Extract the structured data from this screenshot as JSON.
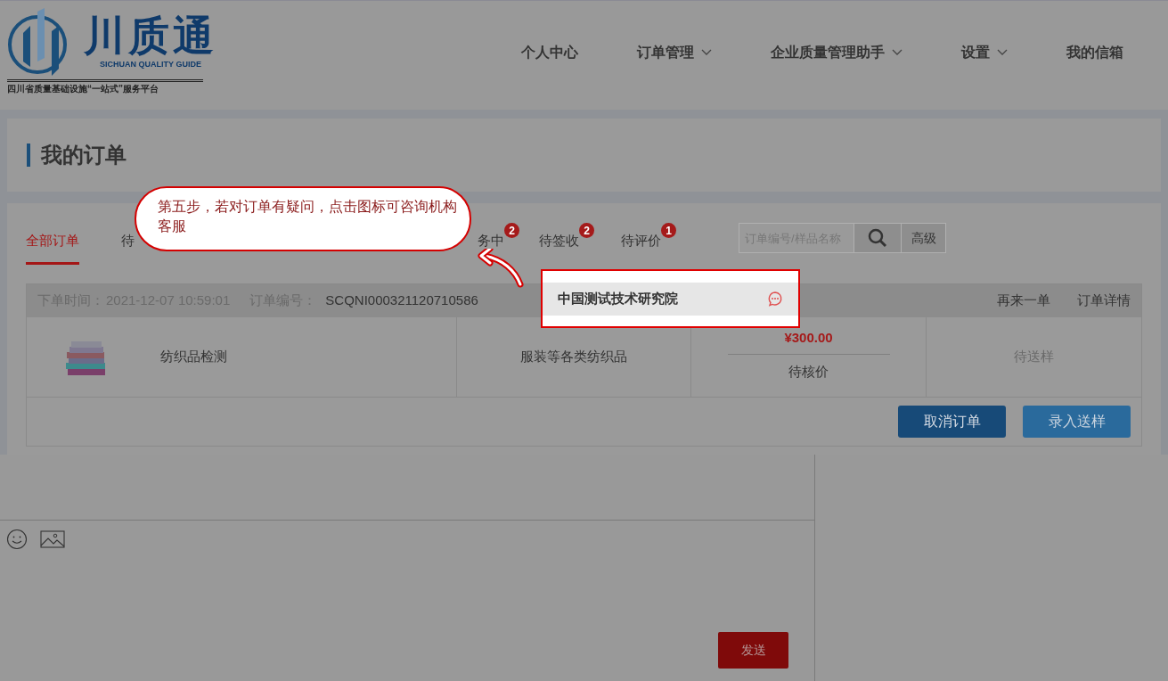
{
  "logo": {
    "name": "川质通",
    "subtitle": "SICHUAN QUALITY GUIDE",
    "slogan": "四川省质量基础设施“一站式”服务平台"
  },
  "nav": [
    {
      "label": "个人中心",
      "dropdown": false
    },
    {
      "label": "订单管理",
      "dropdown": true
    },
    {
      "label": "企业质量管理助手",
      "dropdown": true
    },
    {
      "label": "设置",
      "dropdown": true
    },
    {
      "label": "我的信箱",
      "dropdown": false
    }
  ],
  "page_title": "我的订单",
  "tabs": [
    {
      "label": "全部订单",
      "selected": true
    },
    {
      "label": "待",
      "selected": false
    },
    {
      "label": "务中",
      "selected": false,
      "badge": "2"
    },
    {
      "label": "待签收",
      "selected": false,
      "badge": "2"
    },
    {
      "label": "待评价",
      "selected": false,
      "badge": "1"
    }
  ],
  "search": {
    "placeholder": "订单编号/样品名称",
    "advanced": "高级"
  },
  "order": {
    "time_label": "下单时间：",
    "time": "2021-12-07 10:59:01",
    "number_label": "订单编号：",
    "number": "SCQNI000321120710586",
    "agency": "中国测试技术研究院",
    "actions": [
      "再来一单",
      "订单详情"
    ],
    "product": {
      "name": "纺织品检测"
    },
    "category": "服装等各类纺织品",
    "price": "¥300.00",
    "price_status": "待核价",
    "status": "待送样",
    "buttons": [
      {
        "label": "取消订单",
        "kind": "primary"
      },
      {
        "label": "录入送样",
        "kind": "secondary"
      }
    ]
  },
  "callout": "第五步，若对订单有疑问，点击图标可咨询机构客服",
  "chat": {
    "send": "发送"
  }
}
